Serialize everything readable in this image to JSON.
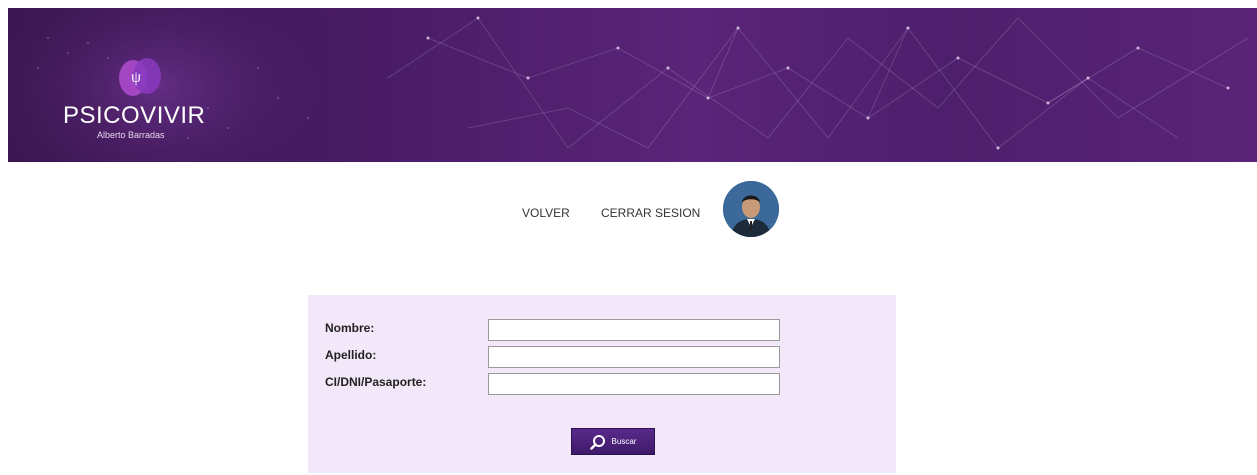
{
  "brand": {
    "title": "PSICOVIVIR",
    "subtitle": "Alberto Barradas"
  },
  "nav": {
    "back_label": "VOLVER",
    "logout_label": "CERRAR SESION"
  },
  "form": {
    "name_label": "Nombre:",
    "lastname_label": "Apellido:",
    "id_label": "CI/DNI/Pasaporte:",
    "name_value": "",
    "lastname_value": "",
    "id_value": "",
    "search_label": "Buscar"
  },
  "colors": {
    "banner": "#4a1c66",
    "panel": "#f3e8f9",
    "button": "#4a1f78"
  }
}
